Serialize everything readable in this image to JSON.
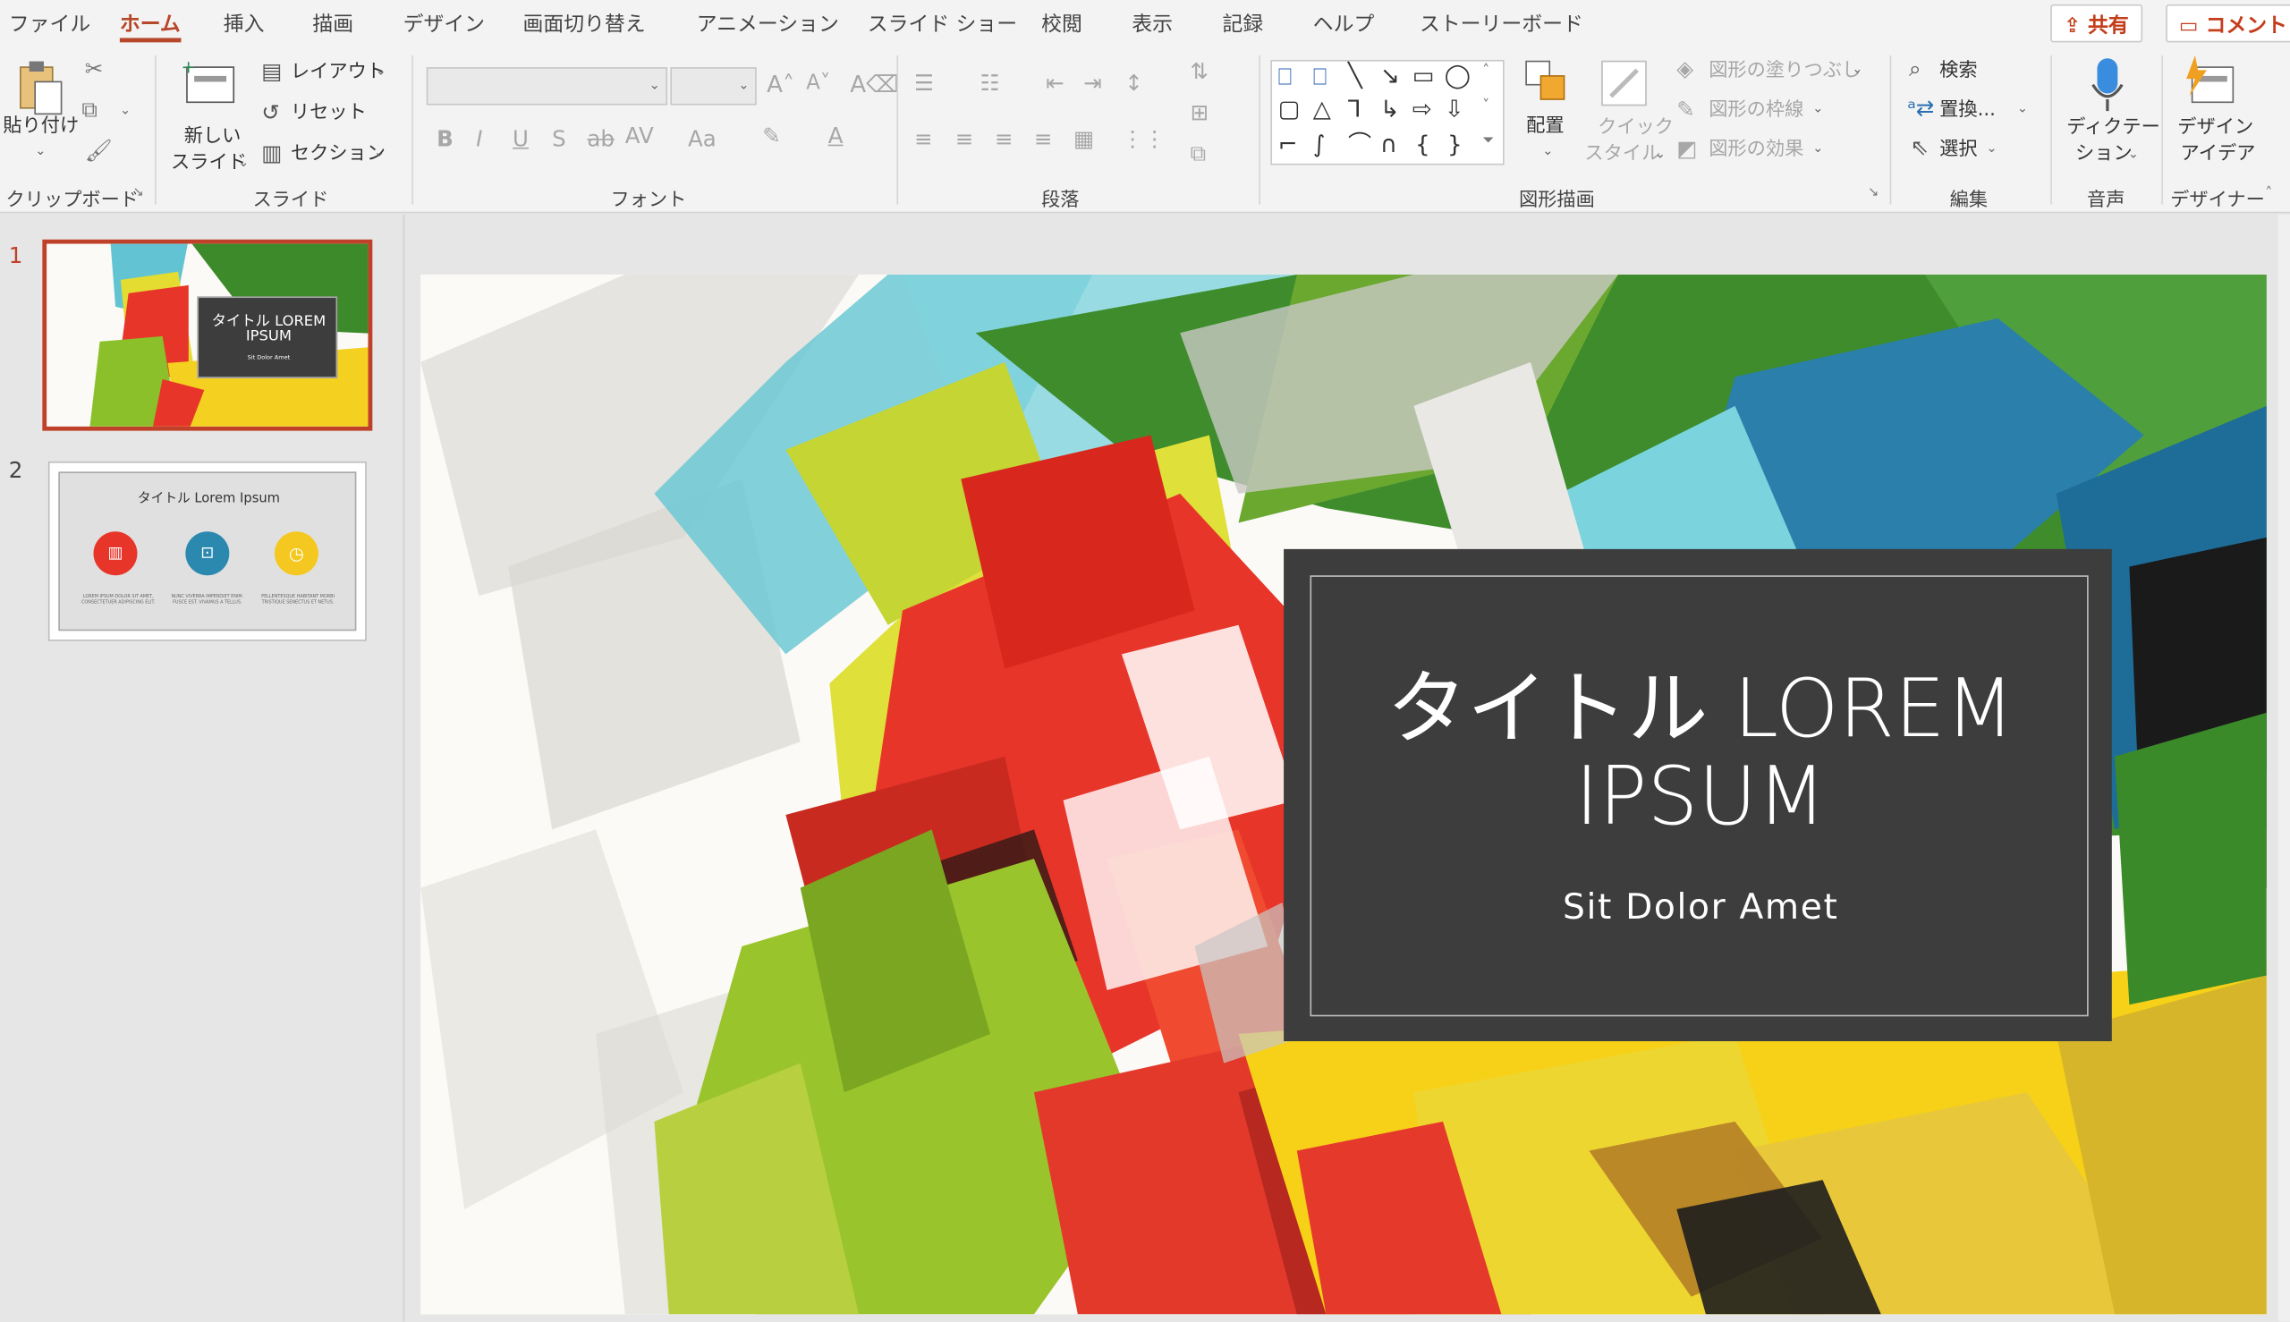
{
  "menu": {
    "tabs": [
      "ファイル",
      "ホーム",
      "挿入",
      "描画",
      "デザイン",
      "画面切り替え",
      "アニメーション",
      "スライド ショー",
      "校閲",
      "表示",
      "記録",
      "ヘルプ",
      "ストーリーボード"
    ],
    "active_tab": "ホーム",
    "share_label": "共有",
    "comment_label": "コメント"
  },
  "ribbon": {
    "clipboard": {
      "paste_label": "貼り付け",
      "group_label": "クリップボード"
    },
    "slides": {
      "new_slide_line1": "新しい",
      "new_slide_line2": "スライド",
      "layout_label": "レイアウト",
      "reset_label": "リセット",
      "section_label": "セクション",
      "group_label": "スライド"
    },
    "font": {
      "font_name": "",
      "font_size": "",
      "group_label": "フォント"
    },
    "paragraph": {
      "group_label": "段落"
    },
    "drawing": {
      "arrange_label": "配置",
      "quick_style_line1": "クイック",
      "quick_style_line2": "スタイル",
      "fill_label": "図形の塗りつぶし",
      "outline_label": "図形の枠線",
      "effects_label": "図形の効果",
      "group_label": "図形描画"
    },
    "editing": {
      "find_label": "検索",
      "replace_label": "置換...",
      "select_label": "選択",
      "group_label": "編集"
    },
    "voice": {
      "dictate_line1": "ディクテー",
      "dictate_line2": "ション",
      "group_label": "音声"
    },
    "designer": {
      "ideas_line1": "デザイン",
      "ideas_line2": "アイデア",
      "group_label": "デザイナー"
    }
  },
  "slides_panel": {
    "slide1": {
      "number": "1",
      "title_line1": "タイトル LOREM",
      "title_line2": "IPSUM",
      "subtitle": "Sit Dolor Amet"
    },
    "slide2": {
      "number": "2",
      "title": "タイトル Lorem Ipsum",
      "captions": [
        "LOREM IPSUM DOLOR SIT AMET, CONSECTETUER ADIPISCING ELIT.",
        "NUNC VIVERRA IMPERDIET ENIM. FUSCE EST. VIVAMUS A TELLUS.",
        "PELLENTESQUE HABITANT MORBI TRISTIQUE SENECTUS ET NETUS."
      ]
    }
  },
  "slide": {
    "title_line1": "タイトル LOREM",
    "title_line2": "IPSUM",
    "subtitle": "Sit Dolor Amet"
  },
  "colors": {
    "accent": "#b7472a",
    "title_box": "#3d3d3d",
    "green": "#3d8a2a",
    "red": "#e8352a",
    "yellow": "#f4d020",
    "blue": "#2b89b0",
    "cyan": "#5ec9d6"
  }
}
